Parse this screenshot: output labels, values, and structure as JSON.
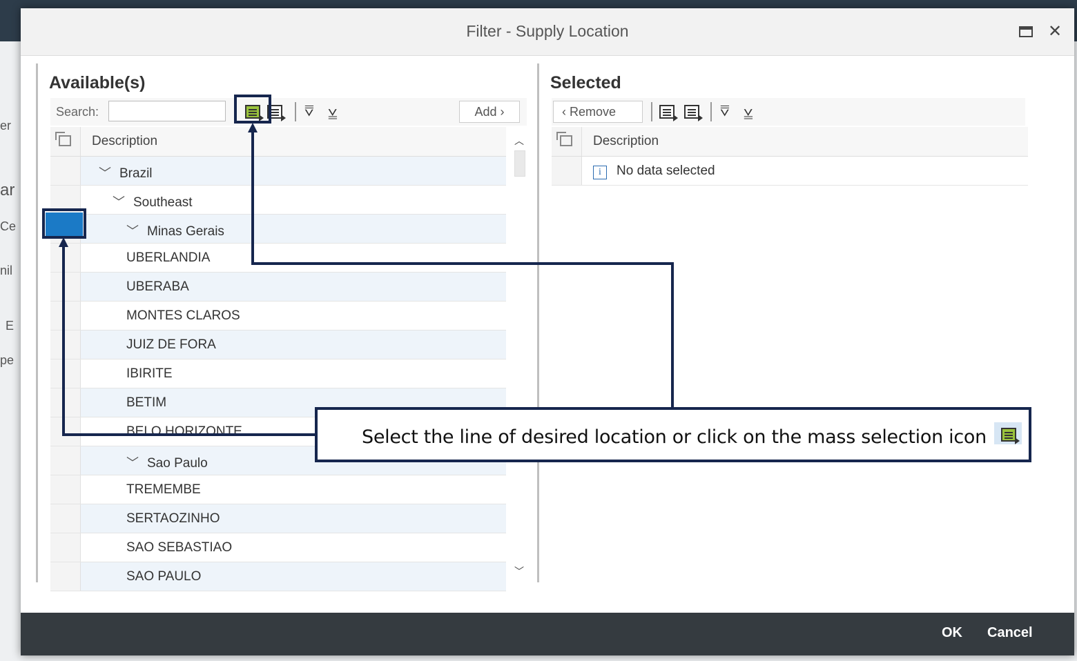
{
  "dialog": {
    "title": "Filter - Supply Location",
    "maximize_icon": "maximize-icon",
    "close_icon": "✕"
  },
  "available": {
    "title": "Available(s)",
    "search_label": "Search:",
    "search_value": "",
    "add_label": "Add ›",
    "column_header": "Description",
    "rows": [
      {
        "text": "Brazil",
        "level": 0,
        "expanded": true
      },
      {
        "text": "Southeast",
        "level": 1,
        "expanded": true
      },
      {
        "text": "Minas Gerais",
        "level": 2,
        "expanded": true
      },
      {
        "text": "UBERLANDIA",
        "level": 3
      },
      {
        "text": "UBERABA",
        "level": 3
      },
      {
        "text": "MONTES CLAROS",
        "level": 3
      },
      {
        "text": "JUIZ DE FORA",
        "level": 3
      },
      {
        "text": "IBIRITE",
        "level": 3
      },
      {
        "text": "BETIM",
        "level": 3
      },
      {
        "text": "BELO HORIZONTE",
        "level": 3
      },
      {
        "text": "Sao Paulo",
        "level": 2,
        "expanded": true
      },
      {
        "text": "TREMEMBE",
        "level": 3
      },
      {
        "text": "SERTAOZINHO",
        "level": 3
      },
      {
        "text": "SAO SEBASTIAO",
        "level": 3
      },
      {
        "text": "SAO PAULO",
        "level": 3
      }
    ]
  },
  "selected": {
    "title": "Selected",
    "remove_label": "‹ Remove",
    "column_header": "Description",
    "empty_text": "No data selected"
  },
  "footer": {
    "ok_label": "OK",
    "cancel_label": "Cancel"
  },
  "callout": {
    "text": "Select the line of desired location or click on the mass selection icon"
  },
  "background": {
    "fragments": [
      "er",
      "ar",
      "Ce",
      "nil",
      "E",
      "pe"
    ]
  },
  "colors": {
    "highlight": "#16264e",
    "selection_fill": "#1b7ac6",
    "footer_bg": "#353b40",
    "row_alt": "#eef4fa",
    "mass_select_green": "#9ac33c"
  },
  "icons": {
    "toolbar": [
      "select-all-icon",
      "deselect-all-icon",
      "expand-all-icon",
      "collapse-all-icon"
    ]
  }
}
